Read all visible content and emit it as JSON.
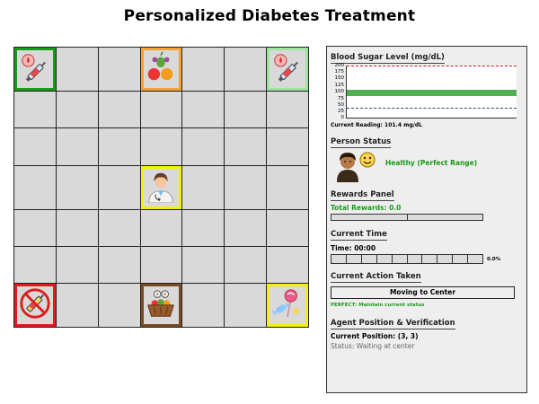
{
  "title": "Personalized Diabetes Treatment",
  "grid": {
    "rows": 7,
    "cols": 7,
    "special_cells": [
      {
        "row": 0,
        "col": 0,
        "icon": "insulin-syringe-icon",
        "border": "#1a9a1a"
      },
      {
        "row": 0,
        "col": 3,
        "icon": "fruit-basket-icon",
        "border": "#f4a23a"
      },
      {
        "row": 0,
        "col": 6,
        "icon": "insulin-syringe-icon",
        "border": "#9ee49e"
      },
      {
        "row": 3,
        "col": 3,
        "icon": "doctor-agent-icon",
        "border": "#f2f200"
      },
      {
        "row": 6,
        "col": 0,
        "icon": "no-insulin-icon",
        "border": "#e01c1c"
      },
      {
        "row": 6,
        "col": 3,
        "icon": "food-basket-icon",
        "border": "#7a4a22"
      },
      {
        "row": 6,
        "col": 6,
        "icon": "candy-icon",
        "border": "#f2f200"
      }
    ]
  },
  "panel": {
    "blood_sugar": {
      "heading": "Blood Sugar Level (mg/dL)",
      "ticks": [
        "200",
        "175",
        "150",
        "125",
        "100",
        "75",
        "50",
        "25",
        "0"
      ],
      "current_reading_label": "Current Reading: 101.4 mg/dL",
      "value": 101.4,
      "upper_limit": 200,
      "lower_limit": 40,
      "healthy_range": [
        95,
        105
      ]
    },
    "person_status": {
      "heading": "Person Status",
      "status": "Healthy (Perfect Range)",
      "status_color": "#1a9a1a"
    },
    "rewards": {
      "heading": "Rewards Panel",
      "total_label": "Total Rewards: 0.0",
      "total_color": "#1a9a1a"
    },
    "time": {
      "heading": "Current Time",
      "time_label": "Time: 00:00",
      "progress_label": "0.0%",
      "progress": 0.0,
      "segments": 10
    },
    "action": {
      "heading": "Current Action Taken",
      "action_text": "Moving to Center",
      "feedback": "PERFECT: Maintain current status",
      "feedback_color": "#1a9a1a"
    },
    "agent": {
      "heading": "Agent Position & Verification",
      "position": "Current Position: (3, 3)",
      "status": "Status: Waiting at center"
    }
  }
}
